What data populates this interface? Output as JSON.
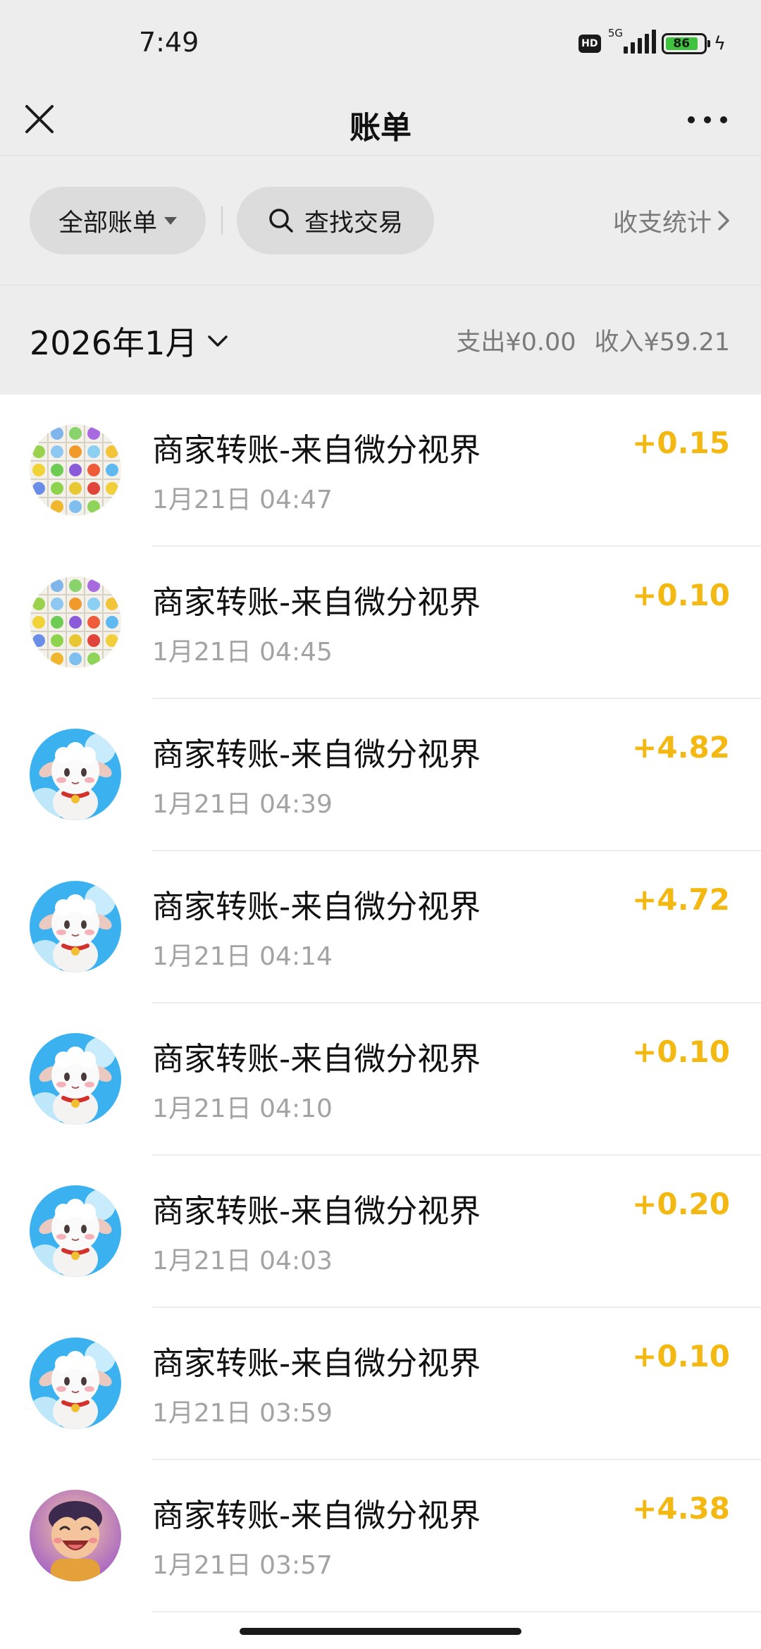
{
  "status_bar": {
    "time": "7:49",
    "hd": "HD",
    "network": "5G",
    "battery": "86",
    "battery_level": 0.86
  },
  "nav": {
    "title": "账单",
    "close_icon": "close-icon",
    "more_icon": "more-dots-icon"
  },
  "filters": {
    "all_bills": "全部账单",
    "search": "查找交易",
    "stats": "收支统计"
  },
  "month": {
    "label": "2026年1月",
    "expense": "支出¥0.00",
    "income": "收入¥59.21"
  },
  "transactions": [
    {
      "title": "商家转账-来自微分视界",
      "time": "1月21日 04:47",
      "amount": "+0.15",
      "avatar": "fruit-puzzle"
    },
    {
      "title": "商家转账-来自微分视界",
      "time": "1月21日 04:45",
      "amount": "+0.10",
      "avatar": "fruit-puzzle"
    },
    {
      "title": "商家转账-来自微分视界",
      "time": "1月21日 04:39",
      "amount": "+4.82",
      "avatar": "sheep"
    },
    {
      "title": "商家转账-来自微分视界",
      "time": "1月21日 04:14",
      "amount": "+4.72",
      "avatar": "sheep"
    },
    {
      "title": "商家转账-来自微分视界",
      "time": "1月21日 04:10",
      "amount": "+0.10",
      "avatar": "sheep"
    },
    {
      "title": "商家转账-来自微分视界",
      "time": "1月21日 04:03",
      "amount": "+0.20",
      "avatar": "sheep"
    },
    {
      "title": "商家转账-来自微分视界",
      "time": "1月21日 03:59",
      "amount": "+0.10",
      "avatar": "sheep"
    },
    {
      "title": "商家转账-来自微分视界",
      "time": "1月21日 03:57",
      "amount": "+4.38",
      "avatar": "cartoon-boy"
    }
  ],
  "colors": {
    "income_amount": "#f3b812",
    "header_bg": "#ededed",
    "secondary_text": "#a3a3a3"
  }
}
